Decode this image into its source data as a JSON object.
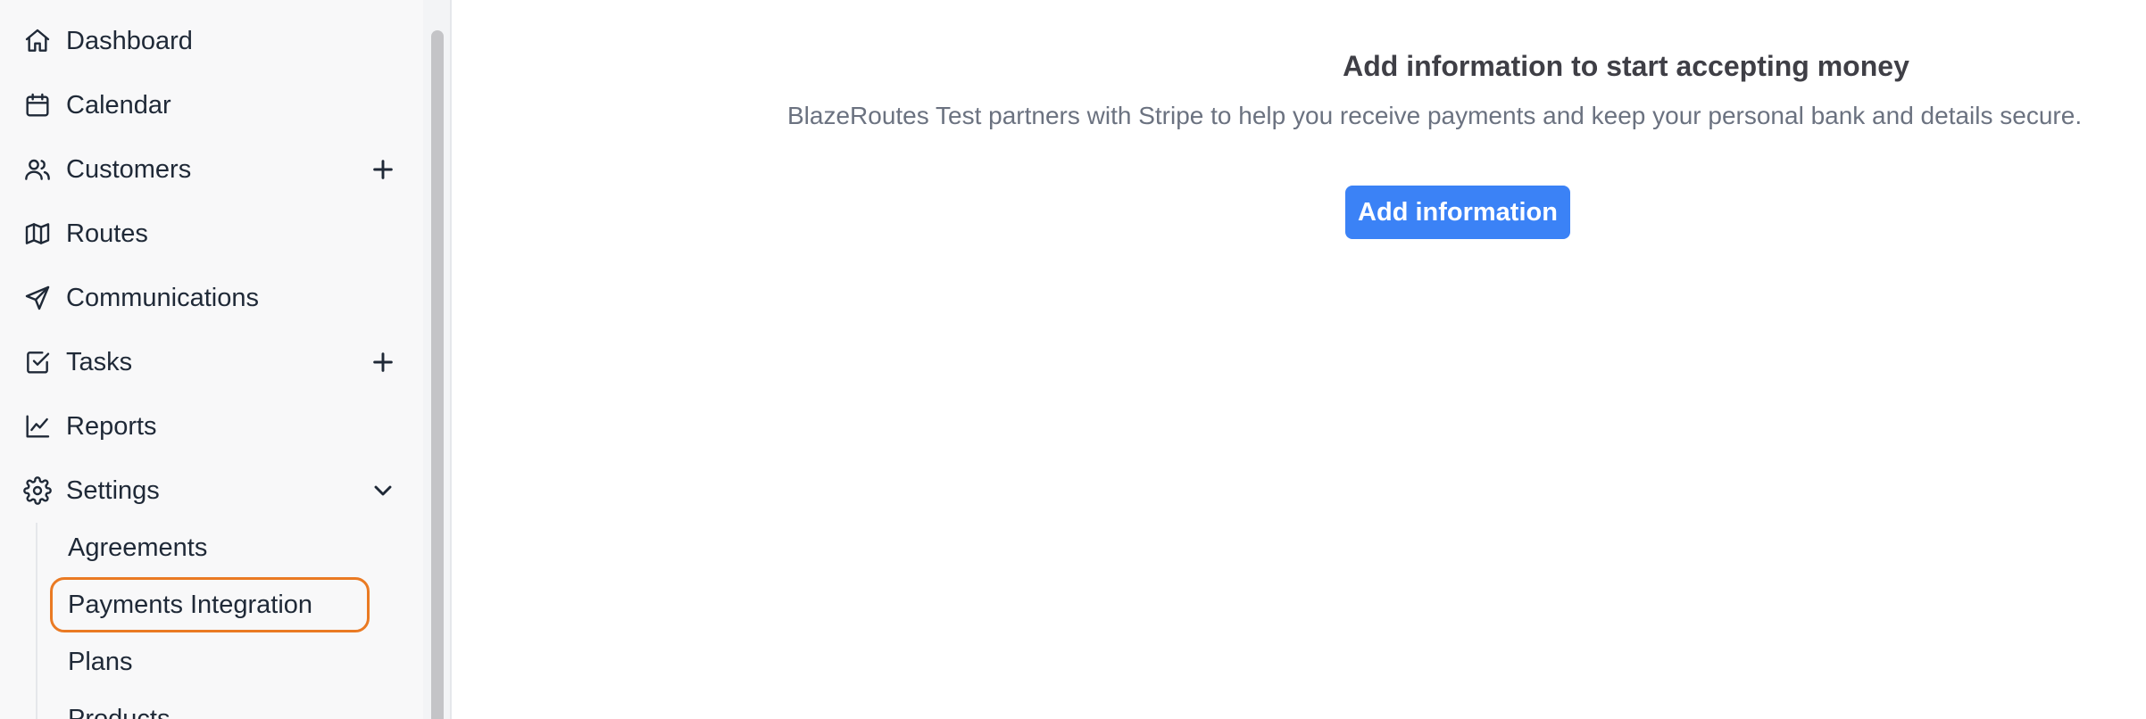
{
  "sidebar": {
    "items": [
      {
        "label": "Dashboard",
        "icon": "home-icon"
      },
      {
        "label": "Calendar",
        "icon": "calendar-icon"
      },
      {
        "label": "Customers",
        "icon": "users-icon",
        "trailing": "plus-icon"
      },
      {
        "label": "Routes",
        "icon": "map-icon"
      },
      {
        "label": "Communications",
        "icon": "send-icon"
      },
      {
        "label": "Tasks",
        "icon": "check-square-icon",
        "trailing": "plus-icon"
      },
      {
        "label": "Reports",
        "icon": "line-chart-icon"
      },
      {
        "label": "Settings",
        "icon": "gear-icon",
        "trailing": "chevron-down-icon"
      }
    ],
    "settings_sub": [
      {
        "label": "Agreements"
      },
      {
        "label": "Payments Integration",
        "active": true
      },
      {
        "label": "Plans"
      },
      {
        "label": "Products"
      }
    ]
  },
  "main": {
    "title": "Add information to start accepting money",
    "description": "BlazeRoutes Test partners with Stripe to help you receive payments and keep your personal bank and details secure.",
    "button_label": "Add information"
  },
  "colors": {
    "accent": "#3b82f6",
    "highlight": "#ea7a23"
  }
}
